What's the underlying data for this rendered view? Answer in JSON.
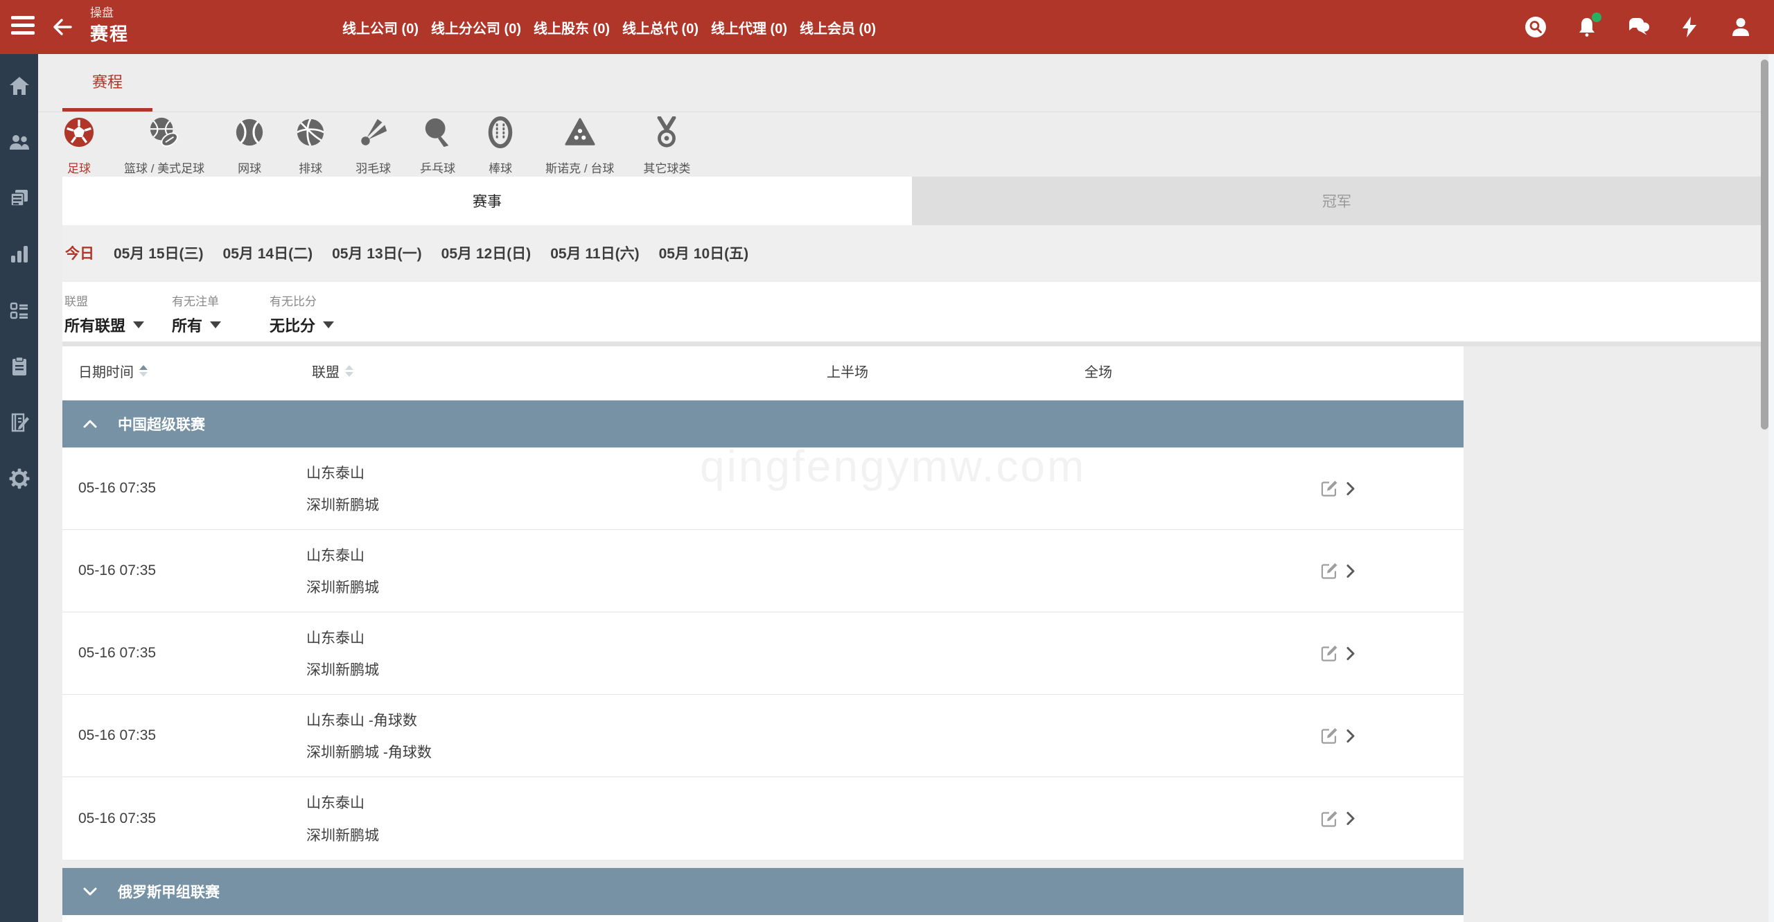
{
  "header": {
    "app_section": "操盘",
    "page_title": "赛程",
    "nav": [
      {
        "label": "线上公司 (0)"
      },
      {
        "label": "线上分公司 (0)"
      },
      {
        "label": "线上股东 (0)"
      },
      {
        "label": "线上总代 (0)"
      },
      {
        "label": "线上代理 (0)"
      },
      {
        "label": "线上会员 (0)"
      }
    ],
    "icons": [
      "search-icon",
      "notifications-bell-icon",
      "chat-icon",
      "lightning-icon",
      "account-icon"
    ],
    "notification_dot": true
  },
  "sidebar": {
    "icons": [
      "home-icon",
      "users-icon",
      "documents-icon",
      "bar-chart-icon",
      "ballot-list-icon",
      "clipboard-icon",
      "ledger-edit-icon",
      "settings-gear-icon"
    ]
  },
  "page_tab": {
    "label": "赛程"
  },
  "sports": [
    {
      "label": "足球",
      "icon": "soccer-icon",
      "active": true
    },
    {
      "label": "篮球 / 美式足球",
      "icon": "basketball-football-icon",
      "active": false
    },
    {
      "label": "网球",
      "icon": "tennis-icon",
      "active": false
    },
    {
      "label": "排球",
      "icon": "volleyball-icon",
      "active": false
    },
    {
      "label": "羽毛球",
      "icon": "badminton-icon",
      "active": false
    },
    {
      "label": "乒乓球",
      "icon": "table-tennis-icon",
      "active": false
    },
    {
      "label": "棒球",
      "icon": "baseball-icon",
      "active": false
    },
    {
      "label": "斯诺克 / 台球",
      "icon": "snooker-icon",
      "active": false
    },
    {
      "label": "其它球类",
      "icon": "medal-icon",
      "active": false
    }
  ],
  "view_tabs": [
    {
      "label": "赛事",
      "active": true
    },
    {
      "label": "冠军",
      "active": false
    }
  ],
  "date_filters": [
    {
      "label": "今日",
      "active": true
    },
    {
      "label": "05月 15日(三)",
      "active": false
    },
    {
      "label": "05月 14日(二)",
      "active": false
    },
    {
      "label": "05月 13日(一)",
      "active": false
    },
    {
      "label": "05月 12日(日)",
      "active": false
    },
    {
      "label": "05月 11日(六)",
      "active": false
    },
    {
      "label": "05月 10日(五)",
      "active": false
    }
  ],
  "filters": [
    {
      "label": "联盟",
      "value": "所有联盟"
    },
    {
      "label": "有无注单",
      "value": "所有"
    },
    {
      "label": "有无比分",
      "value": "无比分"
    }
  ],
  "table": {
    "columns": [
      {
        "label": "日期时间",
        "sortable": true,
        "sorted": "asc"
      },
      {
        "label": "联盟",
        "sortable": true,
        "sorted": ""
      },
      {
        "label": "上半场",
        "sortable": false
      },
      {
        "label": "全场",
        "sortable": false
      }
    ],
    "groups": [
      {
        "name": "中国超级联赛",
        "expanded": true,
        "rows": [
          {
            "time": "05-16 07:35",
            "home": "山东泰山",
            "away": "深圳新鹏城"
          },
          {
            "time": "05-16 07:35",
            "home": "山东泰山",
            "away": "深圳新鹏城"
          },
          {
            "time": "05-16 07:35",
            "home": "山东泰山",
            "away": "深圳新鹏城"
          },
          {
            "time": "05-16 07:35",
            "home": "山东泰山 -角球数",
            "away": "深圳新鹏城 -角球数"
          },
          {
            "time": "05-16 07:35",
            "home": "山东泰山",
            "away": "深圳新鹏城"
          }
        ]
      },
      {
        "name": "俄罗斯甲组联赛",
        "expanded": false,
        "rows": []
      }
    ]
  },
  "watermark": "qingfengymw.com",
  "colors": {
    "accent_red": "#af3628",
    "sidebar_navy": "#2d3c4d",
    "group_header_blue": "#7692a4",
    "notification_green": "#27ae60",
    "inactive_tab_gray": "#dedede"
  }
}
